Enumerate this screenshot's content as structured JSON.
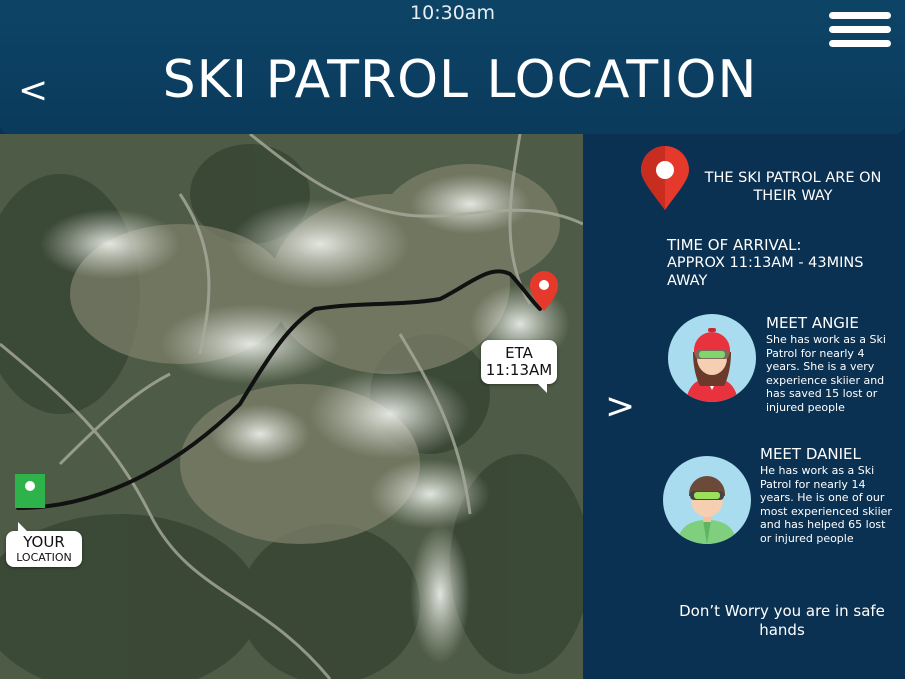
{
  "status_bar": {
    "time": "10:30am"
  },
  "header": {
    "back_label": "<",
    "title": "SKI PATROL LOCATION"
  },
  "map": {
    "eta_label": "ETA",
    "eta_time": "11:13AM",
    "your_label": "YOUR",
    "location_label": "LOCATION",
    "route_color": "#111111",
    "patrol_pin_color": "#e53a2b",
    "user_pin_color": "#2eb24a"
  },
  "panel": {
    "message": "THE SKI PATROL ARE ON THEIR WAY",
    "arrival_heading": "TIME OF ARRIVAL:",
    "arrival_detail": "APPROX 11:13AM - 43MINS AWAY",
    "next_label": ">",
    "patrollers": [
      {
        "name": "MEET ANGIE",
        "bio": "She has work as a Ski Patrol for nearly 4 years. She is a very experience skiier and has saved 15 lost or injured people",
        "helmet_color": "#e8333f"
      },
      {
        "name": "MEET DANIEL",
        "bio": "He has work as a Ski Patrol for nearly 14 years. He is one of our most experienced skiier and has helped 65 lost or injured people",
        "helmet_color": "#6b4a3a"
      }
    ],
    "reassurance": "Don’t Worry you are in safe hands"
  },
  "colors": {
    "header_bg": "#0d4466",
    "panel_bg": "#0b3152"
  }
}
